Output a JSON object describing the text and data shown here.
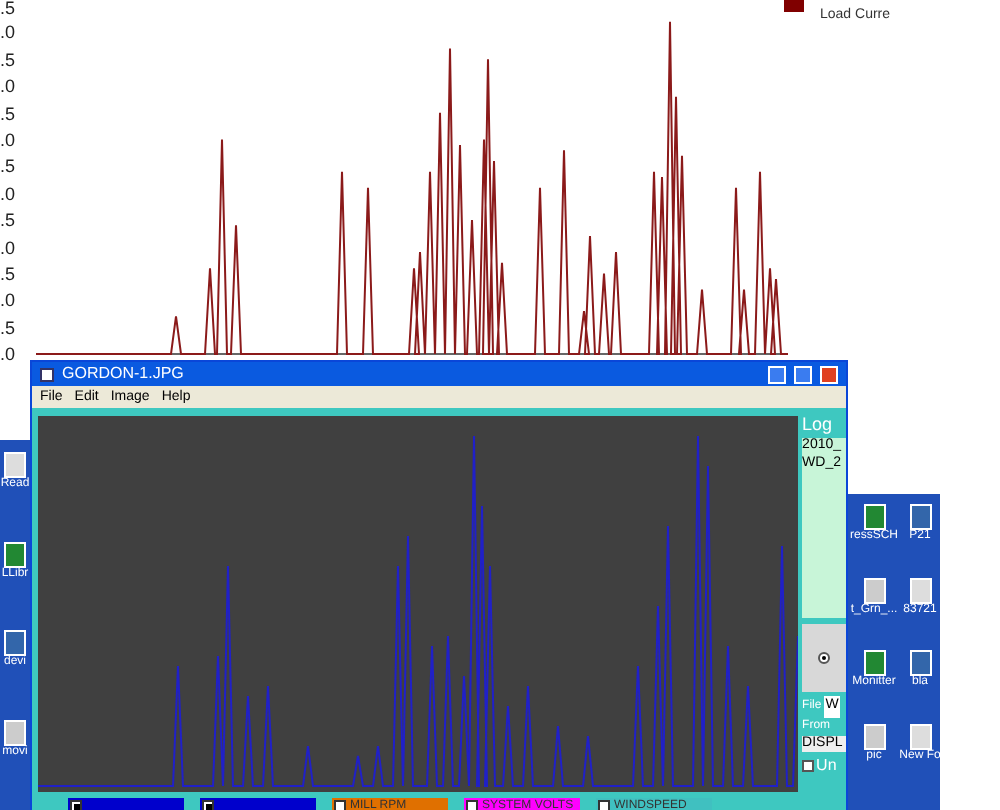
{
  "chart": {
    "yticks": [
      ".5",
      ".0",
      ".5",
      ".0",
      ".5",
      ".0",
      ".5",
      ".0",
      ".5",
      ".0",
      ".5",
      ".0",
      ".5",
      ".0"
    ],
    "legend": {
      "label": "Load Curre",
      "color": "#800000"
    }
  },
  "window": {
    "title": "GORDON-1.JPG",
    "menu": [
      "File",
      "Edit",
      "Image",
      "Help"
    ],
    "side_panel": {
      "heading": "Log",
      "log_lines": [
        "2010_",
        "WD_2"
      ],
      "radio_selected": true,
      "file_label": "File",
      "file_value": "W",
      "from_label": "From",
      "display_button": "DISPL",
      "checkbox_label": "Un",
      "checkbox_checked": false
    },
    "channels": [
      {
        "color": "#0000cc",
        "checked": true
      },
      {
        "color": "#0000cc",
        "checked": true
      },
      {
        "label": "MILL RPM",
        "color": "#e07000",
        "checked": false
      },
      {
        "label": "SYSTEM VOLTS",
        "color": "#ff00ff",
        "checked": false
      },
      {
        "label": "WINDSPEED",
        "color": "#40c0c0",
        "checked": false
      }
    ]
  },
  "desktop": {
    "left_icons": [
      "Read",
      "LLibr",
      "devi",
      "movi"
    ],
    "right_icons": [
      "ressSCH",
      "P21",
      "t_Grn_...",
      "83721",
      "Monitter",
      "bla",
      "pic",
      "New Fo"
    ]
  }
}
